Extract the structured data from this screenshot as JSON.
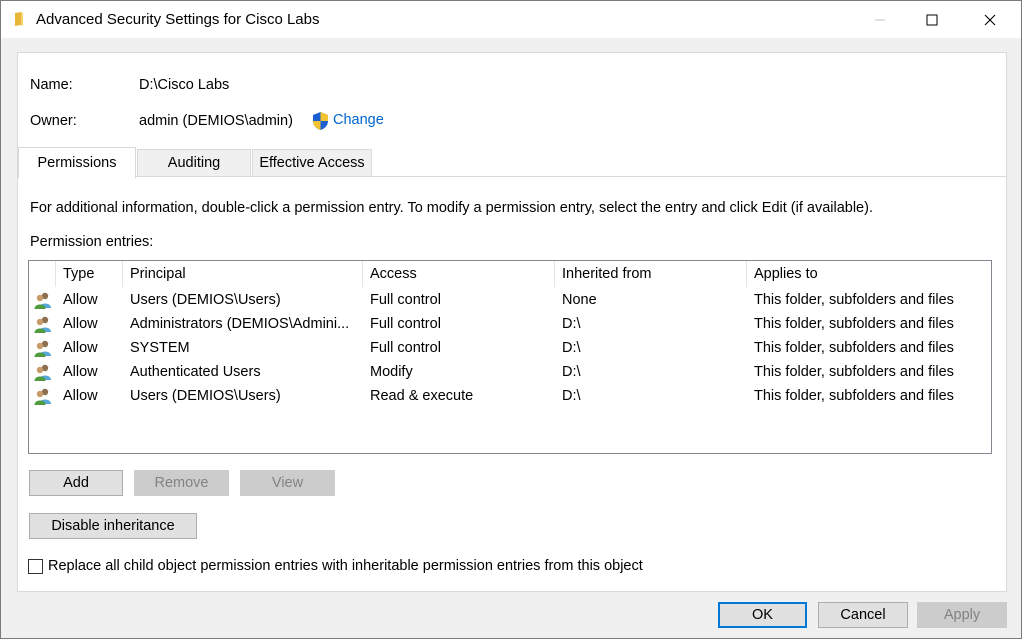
{
  "window": {
    "title": "Advanced Security Settings for Cisco Labs"
  },
  "info": {
    "name_label": "Name:",
    "name_value": "D:\\Cisco Labs",
    "owner_label": "Owner:",
    "owner_value": "admin (DEMIOS\\admin)",
    "change_label": "Change"
  },
  "tabs": [
    {
      "label": "Permissions",
      "active": true
    },
    {
      "label": "Auditing",
      "active": false
    },
    {
      "label": "Effective Access",
      "active": false
    }
  ],
  "instructions": "For additional information, double-click a permission entry. To modify a permission entry, select the entry and click Edit (if available).",
  "entries_label": "Permission entries:",
  "columns": [
    "Type",
    "Principal",
    "Access",
    "Inherited from",
    "Applies to"
  ],
  "entries": [
    {
      "type": "Allow",
      "principal": "Users (DEMIOS\\Users)",
      "access": "Full control",
      "inherited": "None",
      "applies": "This folder, subfolders and files"
    },
    {
      "type": "Allow",
      "principal": "Administrators (DEMIOS\\Admini...",
      "access": "Full control",
      "inherited": "D:\\",
      "applies": "This folder, subfolders and files"
    },
    {
      "type": "Allow",
      "principal": "SYSTEM",
      "access": "Full control",
      "inherited": "D:\\",
      "applies": "This folder, subfolders and files"
    },
    {
      "type": "Allow",
      "principal": "Authenticated Users",
      "access": "Modify",
      "inherited": "D:\\",
      "applies": "This folder, subfolders and files"
    },
    {
      "type": "Allow",
      "principal": "Users (DEMIOS\\Users)",
      "access": "Read & execute",
      "inherited": "D:\\",
      "applies": "This folder, subfolders and files"
    }
  ],
  "buttons": {
    "add": "Add",
    "remove": "Remove",
    "view": "View",
    "disable_inheritance": "Disable inheritance",
    "ok": "OK",
    "cancel": "Cancel",
    "apply": "Apply"
  },
  "replace_checkbox": {
    "label": "Replace all child object permission entries with inheritable permission entries from this object",
    "checked": false
  },
  "colors": {
    "link": "#0066cc",
    "accent": "#0078d7"
  }
}
